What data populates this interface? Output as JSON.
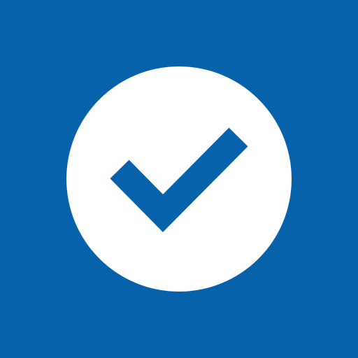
{
  "icon": {
    "name": "checkmark-in-circle",
    "background_color": "#0662aa",
    "circle_color": "#ffffff",
    "check_color": "#0662aa"
  }
}
